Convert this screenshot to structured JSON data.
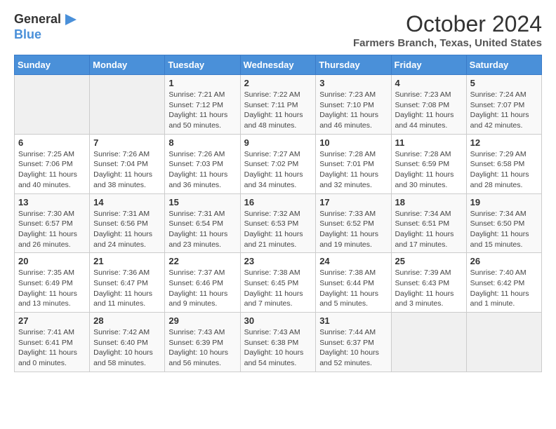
{
  "logo": {
    "line1": "General",
    "line2": "Blue"
  },
  "title": "October 2024",
  "location": "Farmers Branch, Texas, United States",
  "days_of_week": [
    "Sunday",
    "Monday",
    "Tuesday",
    "Wednesday",
    "Thursday",
    "Friday",
    "Saturday"
  ],
  "weeks": [
    [
      {
        "day": "",
        "sunrise": "",
        "sunset": "",
        "daylight": ""
      },
      {
        "day": "",
        "sunrise": "",
        "sunset": "",
        "daylight": ""
      },
      {
        "day": "1",
        "sunrise": "Sunrise: 7:21 AM",
        "sunset": "Sunset: 7:12 PM",
        "daylight": "Daylight: 11 hours and 50 minutes."
      },
      {
        "day": "2",
        "sunrise": "Sunrise: 7:22 AM",
        "sunset": "Sunset: 7:11 PM",
        "daylight": "Daylight: 11 hours and 48 minutes."
      },
      {
        "day": "3",
        "sunrise": "Sunrise: 7:23 AM",
        "sunset": "Sunset: 7:10 PM",
        "daylight": "Daylight: 11 hours and 46 minutes."
      },
      {
        "day": "4",
        "sunrise": "Sunrise: 7:23 AM",
        "sunset": "Sunset: 7:08 PM",
        "daylight": "Daylight: 11 hours and 44 minutes."
      },
      {
        "day": "5",
        "sunrise": "Sunrise: 7:24 AM",
        "sunset": "Sunset: 7:07 PM",
        "daylight": "Daylight: 11 hours and 42 minutes."
      }
    ],
    [
      {
        "day": "6",
        "sunrise": "Sunrise: 7:25 AM",
        "sunset": "Sunset: 7:06 PM",
        "daylight": "Daylight: 11 hours and 40 minutes."
      },
      {
        "day": "7",
        "sunrise": "Sunrise: 7:26 AM",
        "sunset": "Sunset: 7:04 PM",
        "daylight": "Daylight: 11 hours and 38 minutes."
      },
      {
        "day": "8",
        "sunrise": "Sunrise: 7:26 AM",
        "sunset": "Sunset: 7:03 PM",
        "daylight": "Daylight: 11 hours and 36 minutes."
      },
      {
        "day": "9",
        "sunrise": "Sunrise: 7:27 AM",
        "sunset": "Sunset: 7:02 PM",
        "daylight": "Daylight: 11 hours and 34 minutes."
      },
      {
        "day": "10",
        "sunrise": "Sunrise: 7:28 AM",
        "sunset": "Sunset: 7:01 PM",
        "daylight": "Daylight: 11 hours and 32 minutes."
      },
      {
        "day": "11",
        "sunrise": "Sunrise: 7:28 AM",
        "sunset": "Sunset: 6:59 PM",
        "daylight": "Daylight: 11 hours and 30 minutes."
      },
      {
        "day": "12",
        "sunrise": "Sunrise: 7:29 AM",
        "sunset": "Sunset: 6:58 PM",
        "daylight": "Daylight: 11 hours and 28 minutes."
      }
    ],
    [
      {
        "day": "13",
        "sunrise": "Sunrise: 7:30 AM",
        "sunset": "Sunset: 6:57 PM",
        "daylight": "Daylight: 11 hours and 26 minutes."
      },
      {
        "day": "14",
        "sunrise": "Sunrise: 7:31 AM",
        "sunset": "Sunset: 6:56 PM",
        "daylight": "Daylight: 11 hours and 24 minutes."
      },
      {
        "day": "15",
        "sunrise": "Sunrise: 7:31 AM",
        "sunset": "Sunset: 6:54 PM",
        "daylight": "Daylight: 11 hours and 23 minutes."
      },
      {
        "day": "16",
        "sunrise": "Sunrise: 7:32 AM",
        "sunset": "Sunset: 6:53 PM",
        "daylight": "Daylight: 11 hours and 21 minutes."
      },
      {
        "day": "17",
        "sunrise": "Sunrise: 7:33 AM",
        "sunset": "Sunset: 6:52 PM",
        "daylight": "Daylight: 11 hours and 19 minutes."
      },
      {
        "day": "18",
        "sunrise": "Sunrise: 7:34 AM",
        "sunset": "Sunset: 6:51 PM",
        "daylight": "Daylight: 11 hours and 17 minutes."
      },
      {
        "day": "19",
        "sunrise": "Sunrise: 7:34 AM",
        "sunset": "Sunset: 6:50 PM",
        "daylight": "Daylight: 11 hours and 15 minutes."
      }
    ],
    [
      {
        "day": "20",
        "sunrise": "Sunrise: 7:35 AM",
        "sunset": "Sunset: 6:49 PM",
        "daylight": "Daylight: 11 hours and 13 minutes."
      },
      {
        "day": "21",
        "sunrise": "Sunrise: 7:36 AM",
        "sunset": "Sunset: 6:47 PM",
        "daylight": "Daylight: 11 hours and 11 minutes."
      },
      {
        "day": "22",
        "sunrise": "Sunrise: 7:37 AM",
        "sunset": "Sunset: 6:46 PM",
        "daylight": "Daylight: 11 hours and 9 minutes."
      },
      {
        "day": "23",
        "sunrise": "Sunrise: 7:38 AM",
        "sunset": "Sunset: 6:45 PM",
        "daylight": "Daylight: 11 hours and 7 minutes."
      },
      {
        "day": "24",
        "sunrise": "Sunrise: 7:38 AM",
        "sunset": "Sunset: 6:44 PM",
        "daylight": "Daylight: 11 hours and 5 minutes."
      },
      {
        "day": "25",
        "sunrise": "Sunrise: 7:39 AM",
        "sunset": "Sunset: 6:43 PM",
        "daylight": "Daylight: 11 hours and 3 minutes."
      },
      {
        "day": "26",
        "sunrise": "Sunrise: 7:40 AM",
        "sunset": "Sunset: 6:42 PM",
        "daylight": "Daylight: 11 hours and 1 minute."
      }
    ],
    [
      {
        "day": "27",
        "sunrise": "Sunrise: 7:41 AM",
        "sunset": "Sunset: 6:41 PM",
        "daylight": "Daylight: 11 hours and 0 minutes."
      },
      {
        "day": "28",
        "sunrise": "Sunrise: 7:42 AM",
        "sunset": "Sunset: 6:40 PM",
        "daylight": "Daylight: 10 hours and 58 minutes."
      },
      {
        "day": "29",
        "sunrise": "Sunrise: 7:43 AM",
        "sunset": "Sunset: 6:39 PM",
        "daylight": "Daylight: 10 hours and 56 minutes."
      },
      {
        "day": "30",
        "sunrise": "Sunrise: 7:43 AM",
        "sunset": "Sunset: 6:38 PM",
        "daylight": "Daylight: 10 hours and 54 minutes."
      },
      {
        "day": "31",
        "sunrise": "Sunrise: 7:44 AM",
        "sunset": "Sunset: 6:37 PM",
        "daylight": "Daylight: 10 hours and 52 minutes."
      },
      {
        "day": "",
        "sunrise": "",
        "sunset": "",
        "daylight": ""
      },
      {
        "day": "",
        "sunrise": "",
        "sunset": "",
        "daylight": ""
      }
    ]
  ]
}
